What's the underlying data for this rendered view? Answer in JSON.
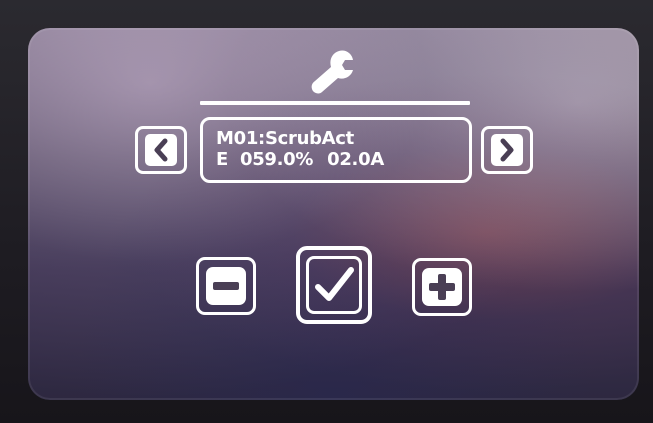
{
  "header": {
    "icon": "wrench-icon"
  },
  "display": {
    "line1": "M01:ScrubAct",
    "mode": "E",
    "percent": "059.0%",
    "current": "02.0A"
  },
  "navigation": {
    "prev_icon": "chevron-left-icon",
    "next_icon": "chevron-right-icon"
  },
  "actions": {
    "minus_icon": "minus-icon",
    "confirm_icon": "checkmark-icon",
    "plus_icon": "plus-icon"
  },
  "colors": {
    "foreground": "#ffffff"
  }
}
